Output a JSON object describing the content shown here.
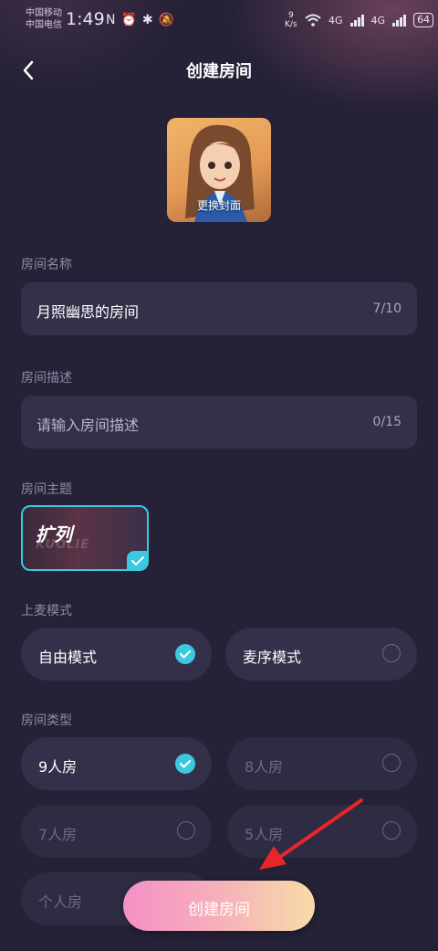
{
  "status_bar": {
    "carrier1": "中国移动",
    "carrier2": "中国电信",
    "time": "1:49",
    "speed": "9",
    "speed_unit": "K/s",
    "network1": "4G",
    "network2": "4G",
    "battery": "64"
  },
  "header": {
    "title": "创建房间",
    "back_icon": "chevron-left-icon"
  },
  "cover": {
    "label": "更换封面"
  },
  "room_name": {
    "label": "房间名称",
    "value": "月照幽思的房间",
    "count": "7/10"
  },
  "room_desc": {
    "label": "房间描述",
    "placeholder": "请输入房间描述",
    "count": "0/15"
  },
  "room_theme": {
    "label": "房间主题",
    "theme_title": "扩列",
    "theme_sub": "KUOLIE",
    "accent": "#3cc8e0"
  },
  "mic_mode": {
    "label": "上麦模式",
    "options": [
      {
        "label": "自由模式",
        "selected": true
      },
      {
        "label": "麦序模式",
        "selected": false
      }
    ]
  },
  "room_type": {
    "label": "房间类型",
    "options": [
      {
        "label": "9人房",
        "selected": true
      },
      {
        "label": "8人房",
        "selected": false
      },
      {
        "label": "7人房",
        "selected": false
      },
      {
        "label": "5人房",
        "selected": false
      },
      {
        "label": "个人房",
        "selected": false
      }
    ]
  },
  "create_button": {
    "label": "创建房间"
  },
  "colors": {
    "background": "#252136",
    "card": "#35304a",
    "accent": "#3cc8e0",
    "arrow": "#e8262a"
  }
}
